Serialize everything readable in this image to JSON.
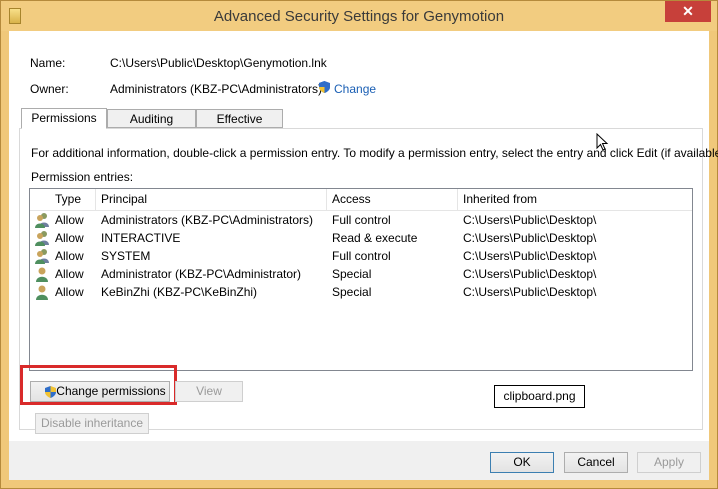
{
  "window": {
    "title": "Advanced Security Settings for Genymotion",
    "close_label": "✕"
  },
  "info": {
    "name_label": "Name:",
    "name_value": "C:\\Users\\Public\\Desktop\\Genymotion.lnk",
    "owner_label": "Owner:",
    "owner_value": "Administrators (KBZ-PC\\Administrators)",
    "change_link": "Change"
  },
  "tabs": [
    {
      "label": "Permissions",
      "active": true
    },
    {
      "label": "Auditing",
      "active": false
    },
    {
      "label": "Effective Access",
      "active": false
    }
  ],
  "permissions": {
    "info_text": "For additional information, double-click a permission entry. To modify a permission entry, select the entry and click Edit (if available).",
    "entries_label": "Permission entries:",
    "columns": [
      "Type",
      "Principal",
      "Access",
      "Inherited from"
    ],
    "rows": [
      {
        "icon": "group-icon",
        "type": "Allow",
        "principal": "Administrators (KBZ-PC\\Administrators)",
        "access": "Full control",
        "inherited": "C:\\Users\\Public\\Desktop\\"
      },
      {
        "icon": "group-icon",
        "type": "Allow",
        "principal": "INTERACTIVE",
        "access": "Read & execute",
        "inherited": "C:\\Users\\Public\\Desktop\\"
      },
      {
        "icon": "group-icon",
        "type": "Allow",
        "principal": "SYSTEM",
        "access": "Full control",
        "inherited": "C:\\Users\\Public\\Desktop\\"
      },
      {
        "icon": "user-icon",
        "type": "Allow",
        "principal": "Administrator (KBZ-PC\\Administrator)",
        "access": "Special",
        "inherited": "C:\\Users\\Public\\Desktop\\"
      },
      {
        "icon": "user-icon",
        "type": "Allow",
        "principal": "KeBinZhi (KBZ-PC\\KeBinZhi)",
        "access": "Special",
        "inherited": "C:\\Users\\Public\\Desktop\\"
      }
    ],
    "change_permissions_label": "Change permissions",
    "view_label": "View",
    "disable_inheritance_label": "Disable inheritance"
  },
  "overlay": {
    "clipboard_label": "clipboard.png"
  },
  "footer": {
    "ok_label": "OK",
    "cancel_label": "Cancel",
    "apply_label": "Apply"
  },
  "colors": {
    "titlebar": "#f2cc80",
    "close": "#c7403a",
    "link": "#1a5fb4",
    "highlight": "#d92a2a"
  }
}
